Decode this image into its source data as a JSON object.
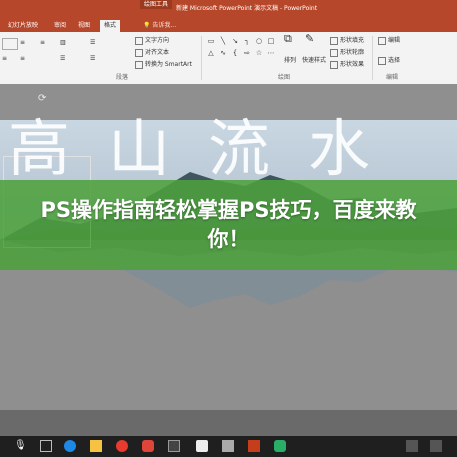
{
  "window": {
    "contextual_tab": "绘图工具",
    "title": "新建 Microsoft PowerPoint 演示文稿 - PowerPoint"
  },
  "ribbon_tabs": [
    {
      "label": "幻灯片放映",
      "active": false
    },
    {
      "label": "审阅",
      "active": false
    },
    {
      "label": "视图",
      "active": false
    },
    {
      "label": "格式",
      "active": true
    }
  ],
  "tell_me": {
    "text": "告诉我..."
  },
  "ribbon": {
    "text_direction": "文字方向",
    "align_text": "对齐文本",
    "convert_smartart": "转换为 SmartArt",
    "paragraph_group": "段落",
    "drawing_group": "绘图",
    "arrange": "排列",
    "quick_styles": "快速样式",
    "shape_fill": "形状填充",
    "shape_outline": "形状轮廓",
    "shape_effects": "形状效果",
    "edit": "编辑",
    "select": "选择",
    "editing_group": "编辑"
  },
  "slide": {
    "calligraphy": "高山流水",
    "headline": "PS操作指南轻松掌握PS技巧，百度来教你！"
  },
  "colors": {
    "accent": "#b7472a",
    "banner": "#4da03c"
  },
  "taskbar": {
    "icons": [
      "start-icon",
      "task-view-icon",
      "edge-icon",
      "file-explorer-icon",
      "netease-music-icon",
      "qq-icon",
      "screenshot-icon",
      "powerpoint-icon",
      "wechat-icon"
    ]
  }
}
